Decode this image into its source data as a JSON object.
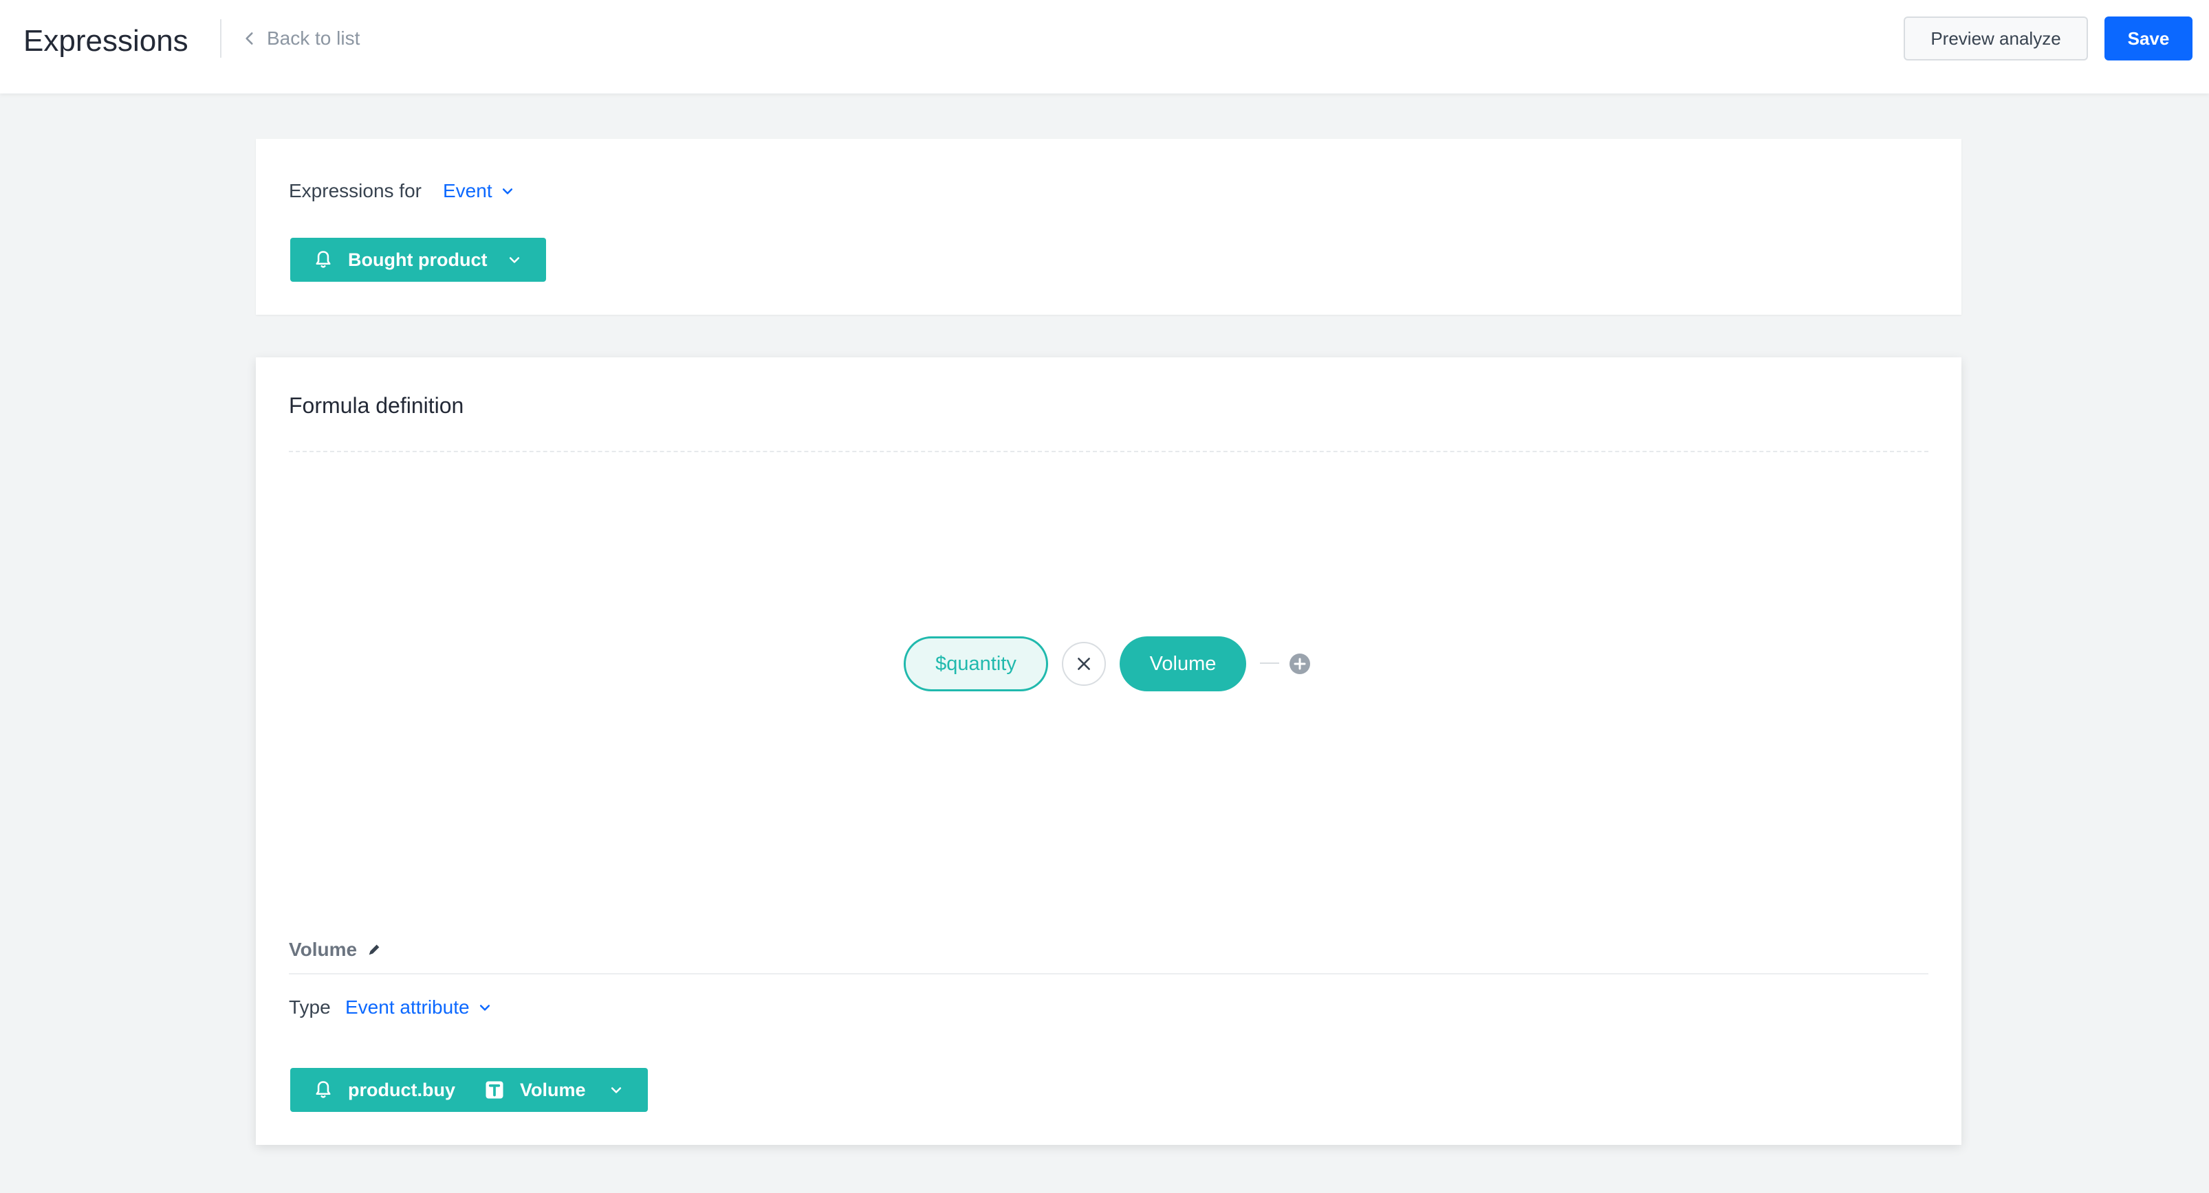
{
  "header": {
    "title": "Expressions",
    "back_label": "Back to list",
    "preview_label": "Preview analyze",
    "save_label": "Save"
  },
  "expressions_for": {
    "label": "Expressions for",
    "value": "Event",
    "event_button": "Bought product"
  },
  "formula": {
    "title": "Formula definition",
    "tokens": {
      "left": "$quantity",
      "right": "Volume"
    },
    "operator_icon": "multiply-icon",
    "add_icon": "plus-circle-icon"
  },
  "variable": {
    "name": "Volume",
    "type_label": "Type",
    "type_value": "Event attribute",
    "event_name": "product.buy",
    "attribute_name": "Volume"
  },
  "colors": {
    "accent_blue": "#0b68ff",
    "teal": "#20b9ad",
    "background": "#f2f4f5"
  }
}
